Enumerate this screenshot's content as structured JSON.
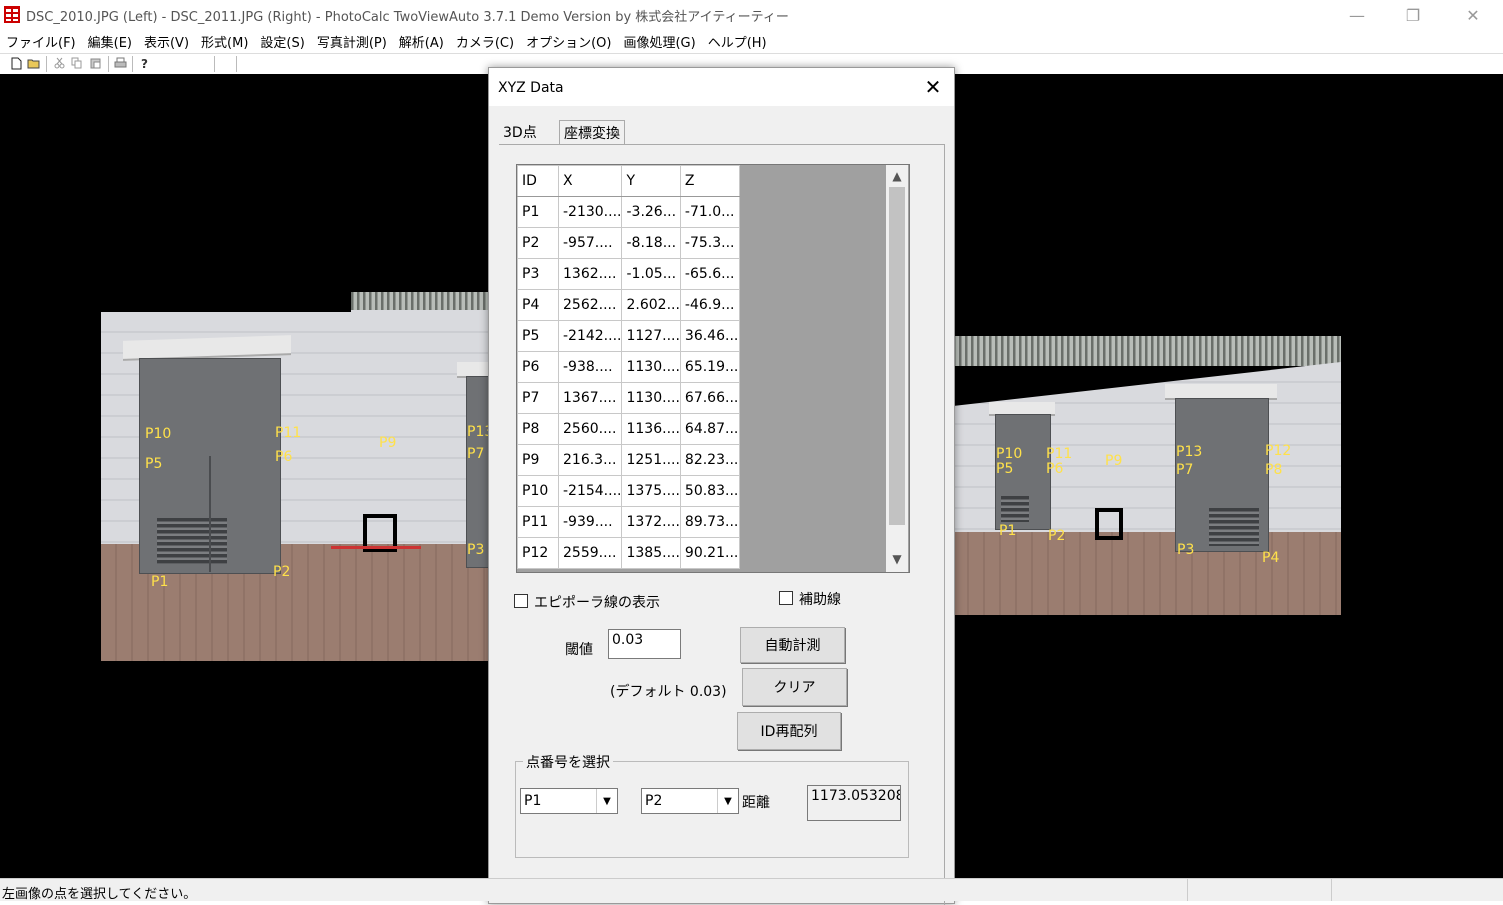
{
  "window": {
    "title": "DSC_2010.JPG (Left) - DSC_2011.JPG (Right) - PhotoCalc TwoViewAuto 3.7.1 Demo Version by 株式会社アイティーティー",
    "minimize_glyph": "—",
    "restore_glyph": "❐",
    "close_glyph": "✕"
  },
  "menu": [
    "ファイル(F)",
    "編集(E)",
    "表示(V)",
    "形式(M)",
    "設定(S)",
    "写真計測(P)",
    "解析(A)",
    "カメラ(C)",
    "オプション(O)",
    "画像処理(G)",
    "ヘルプ(H)"
  ],
  "toolbar_icons": [
    "new-file-icon",
    "open-folder-icon",
    "cut-icon",
    "copy-icon",
    "paste-icon",
    "print-icon",
    "help-icon"
  ],
  "left_photo_points": [
    "P10",
    "P5",
    "P11",
    "P6",
    "P9",
    "P13",
    "P7",
    "P1",
    "P2",
    "P3"
  ],
  "right_photo_points": [
    "P10",
    "P5",
    "P11",
    "P6",
    "P9",
    "P13",
    "P7",
    "P12",
    "P8",
    "P1",
    "P2",
    "P3",
    "P4"
  ],
  "dialog": {
    "title": "XYZ Data",
    "close_glyph": "✕",
    "tabs": [
      "3D点",
      "座標変換"
    ],
    "grid": {
      "headers": [
        "ID",
        "X",
        "Y",
        "Z"
      ],
      "rows": [
        [
          "P1",
          "-2130....",
          "-3.26...",
          "-71.0..."
        ],
        [
          "P2",
          "-957....",
          "-8.18...",
          "-75.3..."
        ],
        [
          "P3",
          "1362....",
          "-1.05...",
          "-65.6..."
        ],
        [
          "P4",
          "2562....",
          "2.602...",
          "-46.9..."
        ],
        [
          "P5",
          "-2142....",
          "1127....",
          "36.46..."
        ],
        [
          "P6",
          "-938....",
          "1130....",
          "65.19..."
        ],
        [
          "P7",
          "1367....",
          "1130....",
          "67.66..."
        ],
        [
          "P8",
          "2560....",
          "1136....",
          "64.87..."
        ],
        [
          "P9",
          "216.3...",
          "1251....",
          "82.23..."
        ],
        [
          "P10",
          "-2154....",
          "1375....",
          "50.83..."
        ],
        [
          "P11",
          "-939....",
          "1372....",
          "89.73..."
        ],
        [
          "P12",
          "2559....",
          "1385....",
          "90.21..."
        ]
      ]
    },
    "epipolar_label": "エピポーラ線の表示",
    "aux_line_label": "補助線",
    "threshold_label": "閾値",
    "threshold_value": "0.03",
    "default_note": "(デフォルト 0.03)",
    "auto_measure_button": "自動計測",
    "clear_button": "クリア",
    "reorder_button": "ID再配列",
    "point_group_label": "点番号を選択",
    "point_a": "P1",
    "point_b": "P2",
    "distance_label": "距離",
    "distance_value": "1173.053208"
  },
  "status": {
    "message": "左画像の点を選択してください。"
  }
}
